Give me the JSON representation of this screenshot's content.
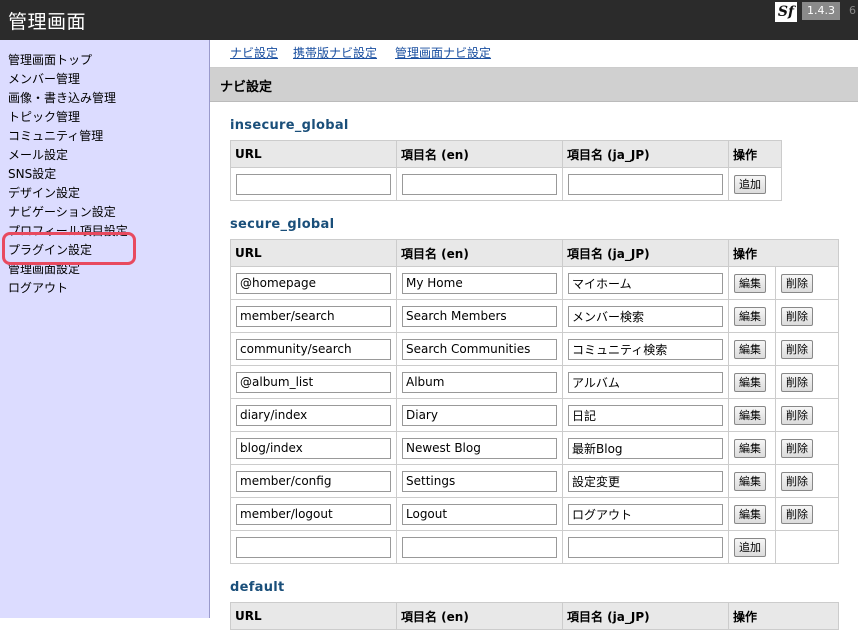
{
  "header": {
    "title": "管理画面",
    "sf_logo": "Sf",
    "version": "1.4.3",
    "extra": "6"
  },
  "sidebar": {
    "items": [
      "管理画面トップ",
      "メンバー管理",
      "画像・書き込み管理",
      "トピック管理",
      "コミュニティ管理",
      "メール設定",
      "SNS設定",
      "デザイン設定",
      "ナビゲーション設定",
      "プロフィール項目設定",
      "プラグイン設定",
      "管理画面設定",
      "ログアウト"
    ]
  },
  "topnav": {
    "links": [
      "ナビ設定",
      "携帯版ナビ設定",
      "管理画面ナビ設定"
    ]
  },
  "section": {
    "heading": "ナビ設定"
  },
  "columns": {
    "url": "URL",
    "en": "項目名 (en)",
    "ja": "項目名 (ja_JP)",
    "ops": "操作"
  },
  "buttons": {
    "add": "追加",
    "edit": "編集",
    "delete": "削除"
  },
  "insecure_global": {
    "title": "insecure_global"
  },
  "secure_global": {
    "title": "secure_global",
    "rows": [
      {
        "url": "@homepage",
        "en": "My Home",
        "ja": "マイホーム"
      },
      {
        "url": "member/search",
        "en": "Search Members",
        "ja": "メンバー検索"
      },
      {
        "url": "community/search",
        "en": "Search Communities",
        "ja": "コミュニティ検索"
      },
      {
        "url": "@album_list",
        "en": "Album",
        "ja": "アルバム"
      },
      {
        "url": "diary/index",
        "en": "Diary",
        "ja": "日記"
      },
      {
        "url": "blog/index",
        "en": "Newest Blog",
        "ja": "最新Blog"
      },
      {
        "url": "member/config",
        "en": "Settings",
        "ja": "設定変更"
      },
      {
        "url": "member/logout",
        "en": "Logout",
        "ja": "ログアウト"
      }
    ]
  },
  "default_group": {
    "title": "default"
  }
}
